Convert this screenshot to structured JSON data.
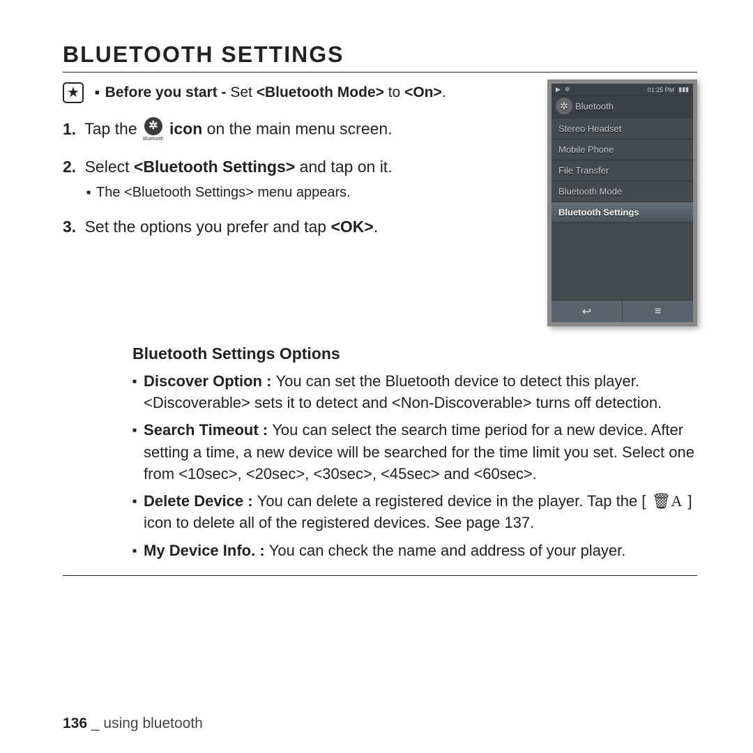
{
  "title": "BLUETOOTH SETTINGS",
  "before_start": {
    "label_bold": "Before you start - ",
    "rest_a": "Set ",
    "rest_b": "<Bluetooth Mode>",
    "rest_c": " to ",
    "rest_d": "<On>",
    "rest_e": "."
  },
  "steps": {
    "s1_num": "1.",
    "s1_a": "Tap the ",
    "s1_icon_label": "Bluetooth",
    "s1_b": " icon",
    "s1_c": " on the main menu screen.",
    "s2_num": "2.",
    "s2_a": "Select ",
    "s2_b": "<Bluetooth Settings>",
    "s2_c": " and tap on it.",
    "s2_sub": "The <Bluetooth Settings> menu appears.",
    "s3_num": "3.",
    "s3_a": "Set the options you prefer and tap ",
    "s3_b": "<OK>",
    "s3_c": "."
  },
  "device": {
    "status_time": "01:25 PM",
    "header": "Bluetooth",
    "items": [
      "Stereo Headset",
      "Mobile Phone",
      "File Transfer",
      "Bluetooth Mode",
      "Bluetooth Settings"
    ],
    "selected_index": 4
  },
  "options_title": "Bluetooth Settings Options",
  "options": [
    {
      "name": "Discover Option : ",
      "body": "You can set the Bluetooth device to detect this player. <Discoverable> sets it to detect and <Non-Discoverable> turns off detection."
    },
    {
      "name": "Search Timeout : ",
      "body": "You can select the search time period for a new device. After setting a time, a new device will be searched for the time limit you set. Select one from <10sec>, <20sec>, <30sec>, <45sec> and <60sec>."
    },
    {
      "name": "Delete Device : ",
      "body_a": "You can delete a registered device in the player. Tap the [ ",
      "icon_text": "🗑A",
      "body_b": " ] icon to delete all of the registered devices. See page 137."
    },
    {
      "name": "My Device Info. : ",
      "body": "You can check the name and address of your player."
    }
  ],
  "footer": {
    "page": "136",
    "sep": " _ ",
    "section": "using bluetooth"
  },
  "glyphs": {
    "bt": "⍖",
    "play": "▶",
    "back": "↩",
    "menu": "≡",
    "bat": "▮▮▮"
  }
}
